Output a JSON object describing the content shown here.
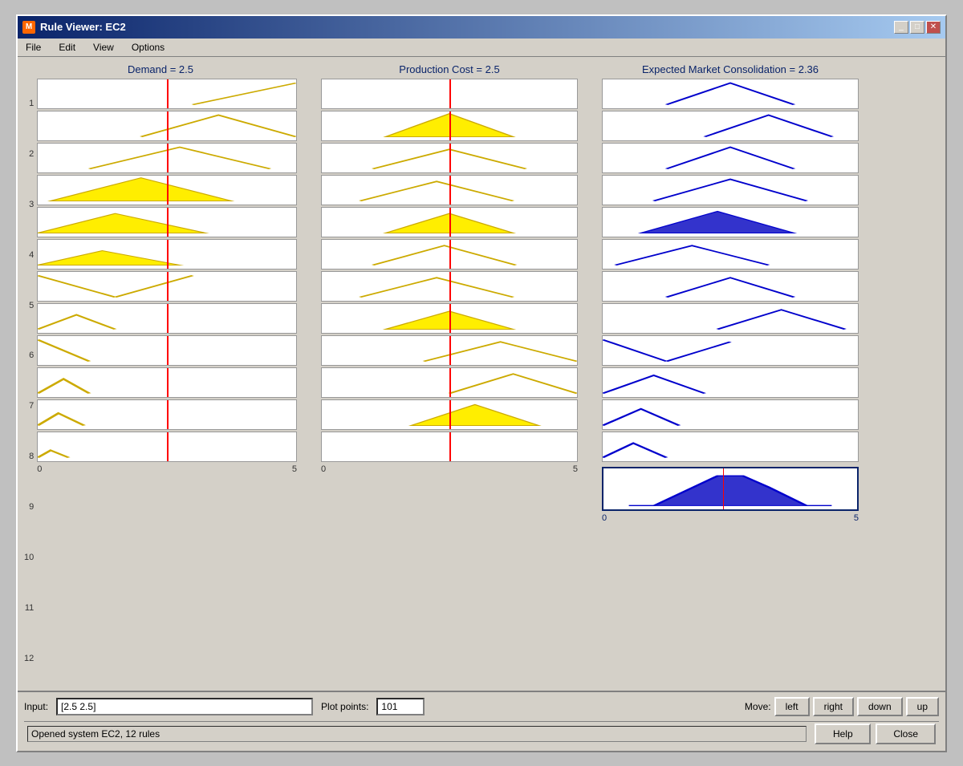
{
  "window": {
    "title": "Rule Viewer: EC2",
    "icon": "M"
  },
  "menu": {
    "items": [
      "File",
      "Edit",
      "View",
      "Options"
    ]
  },
  "headers": {
    "demand": "Demand = 2.5",
    "production_cost": "Production Cost = 2.5",
    "expected_market": "Expected Market Consolidation = 2.36"
  },
  "axes": {
    "input_min": "0",
    "input_max": "5",
    "output_min": "0",
    "output_max": "5"
  },
  "row_numbers": [
    "1",
    "2",
    "3",
    "4",
    "5",
    "6",
    "7",
    "8",
    "9",
    "10",
    "11",
    "12"
  ],
  "bottom": {
    "input_label": "Input:",
    "input_value": "[2.5 2.5]",
    "plot_points_label": "Plot points:",
    "plot_points_value": "101",
    "move_label": "Move:",
    "left_btn": "left",
    "right_btn": "right",
    "down_btn": "down",
    "up_btn": "up",
    "status_text": "Opened system EC2, 12 rules",
    "help_btn": "Help",
    "close_btn": "Close"
  }
}
